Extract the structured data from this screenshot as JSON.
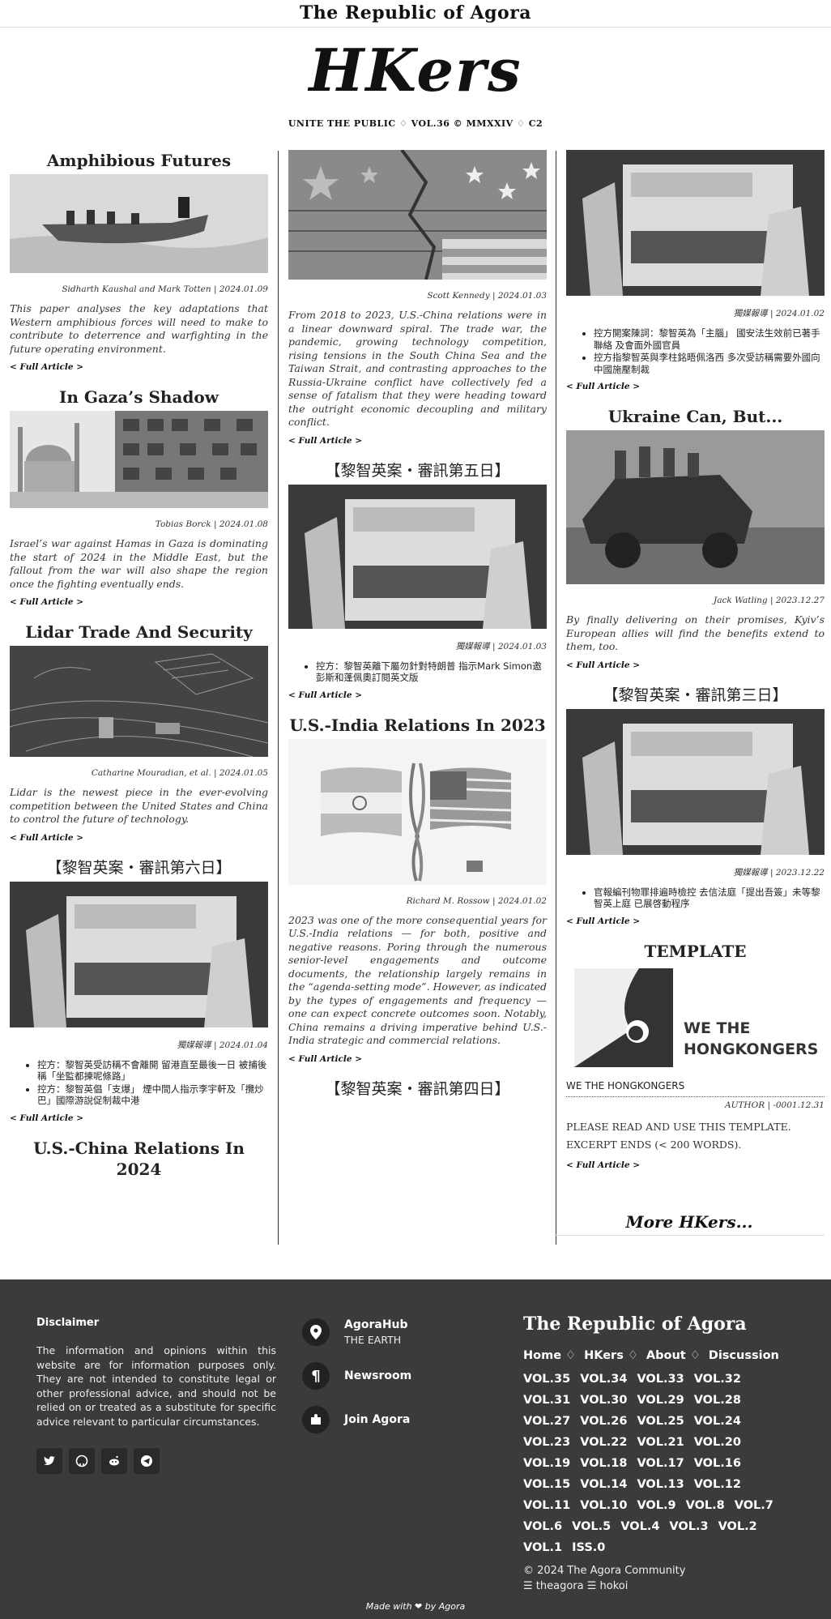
{
  "site": {
    "brand": "The Republic of Agora",
    "logo": "HKers",
    "subtitle": "UNITE THE PUBLIC ♢ VOL.36 © MMXXIV ♢ C2"
  },
  "full_article_label": "< Full Article >",
  "col1": {
    "a1": {
      "title": "Amphibious Futures",
      "byline": "Sidharth Kaushal and Mark Totten | 2024.01.09",
      "excerpt": "This paper analyses the key adaptations that Western amphibious forces will need to make to contribute to deterrence and warfighting in the future operating environment."
    },
    "a2": {
      "title": "In Gaza’s Shadow",
      "byline": "Tobias Borck | 2024.01.08",
      "excerpt": "Israel’s war against Hamas in Gaza is dominating the start of 2024 in the Middle East, but the fallout from the war will also shape the region once the fighting eventually ends."
    },
    "a3": {
      "title": "Lidar Trade And Security",
      "byline": "Catharine Mouradian, et al. | 2024.01.05",
      "excerpt": "Lidar is the newest piece in the ever-evolving competition between the United States and China to control the future of technology."
    },
    "a4": {
      "title": "【黎智英案・審訊第六日】",
      "byline": "獨媒報導 | 2024.01.04",
      "bullets": [
        "控方：黎智英受訪稱不會離開 留港直至最後一日 被捕後稱「坐監都揀呢條路」",
        "控方：黎智英倡「支爆」 煙中間人指示李宇軒及「攬炒巴」國際游說促制裁中港"
      ]
    },
    "a5": {
      "title": "U.S.-China Relations In 2024"
    }
  },
  "col2": {
    "a1": {
      "byline": "Scott Kennedy | 2024.01.03",
      "excerpt": "From 2018 to 2023, U.S.-China relations were in a linear downward spiral. The trade war, the pandemic, growing technology competition, rising tensions in the South China Sea and the Taiwan Strait, and contrasting approaches to the Russia-Ukraine conflict have collectively fed a sense of fatalism that they were heading toward the outright economic decoupling and military conflict."
    },
    "a2": {
      "title": "【黎智英案・審訊第五日】",
      "byline": "獨媒報導 | 2024.01.03",
      "bullets": [
        "控方：黎智英離下屬勿針對特朗普 指示Mark Simon邀彭斯和蓬佩奧訂閱英文版"
      ]
    },
    "a3": {
      "title": "U.S.-India Relations In 2023",
      "byline": "Richard M. Rossow | 2024.01.02",
      "excerpt": "2023 was one of the more consequential years for U.S.-India relations — for both, positive and negative reasons. Poring through the numerous senior-level engagements and outcome documents, the relationship largely remains in the “agenda-setting mode”. However, as indicated by the types of engagements and frequency — one can expect concrete outcomes soon. Notably, China remains a driving imperative behind U.S.-India strategic and commercial relations."
    },
    "a4": {
      "title": "【黎智英案・審訊第四日】"
    }
  },
  "col3": {
    "a1": {
      "byline": "獨媒報導 | 2024.01.02",
      "bullets": [
        "控方開案陳詞：黎智英為「主腦」 國安法生效前已著手聯絡 及會面外國官員",
        "控方指黎智英與李柱銘晤佩洛西 多次受訪稱需要外國向中國施壓制裁"
      ]
    },
    "a2": {
      "title": "Ukraine Can, But...",
      "byline": "Jack Watling | 2023.12.27",
      "excerpt": "By finally delivering on their promises, Kyiv’s European allies will find the benefits extend to them, too."
    },
    "a3": {
      "title": "【黎智英案・審訊第三日】",
      "byline": "獨媒報導 | 2023.12.22",
      "bullets": [
        "官報編刊物罪排遍時檢控 去信法庭「提出吾簽」未等黎智英上庭 已展啓動程序"
      ]
    },
    "a4": {
      "title": "TEMPLATE",
      "logo_text_1": "WE THE",
      "logo_text_2": "HONGKONGERS",
      "line": "WE THE HONGKONGERS",
      "byline": "AUTHOR | -0001.12.31",
      "body": "PLEASE READ AND USE THIS TEMPLATE. EXCERPT ENDS (< 200 WORDS)."
    }
  },
  "more": "More HKers...",
  "footer": {
    "disclaimer_title": "Disclaimer",
    "disclaimer_text": "The information and opinions within this website are for information purposes only. They are not intended to constitute legal or other professional advice, and should not be relied on or treated as a substitute for specific advice relevant to particular circumstances.",
    "social_icons": [
      "twitter-icon",
      "github-icon",
      "reddit-icon",
      "telegram-icon"
    ],
    "links": [
      {
        "label": "AgoraHub",
        "sub": "THE EARTH",
        "icon": "map-pin-icon"
      },
      {
        "label": "Newsroom",
        "sub": "",
        "icon": "pilcrow-icon"
      },
      {
        "label": "Join Agora",
        "sub": "",
        "icon": "puzzle-icon"
      }
    ],
    "brand": "The Republic of Agora",
    "nav": [
      "Home",
      "HKers",
      "About",
      "Discussion"
    ],
    "vols": [
      "VOL.35",
      "VOL.34",
      "VOL.33",
      "VOL.32",
      "VOL.31",
      "VOL.30",
      "VOL.29",
      "VOL.28",
      "VOL.27",
      "VOL.26",
      "VOL.25",
      "VOL.24",
      "VOL.23",
      "VOL.22",
      "VOL.21",
      "VOL.20",
      "VOL.19",
      "VOL.18",
      "VOL.17",
      "VOL.16",
      "VOL.15",
      "VOL.14",
      "VOL.13",
      "VOL.12",
      "VOL.11",
      "VOL.10",
      "VOL.9",
      "VOL.8",
      "VOL.7",
      "VOL.6",
      "VOL.5",
      "VOL.4",
      "VOL.3",
      "VOL.2",
      "VOL.1",
      "ISS.0"
    ],
    "copyright": "© 2024 The Agora Community",
    "credits": "☰ theagora ☰ hokoi",
    "made_with": "Made with ❤ by Agora"
  },
  "colors": {
    "footer_bg": "#3b3b3b",
    "rule": "#333333"
  }
}
